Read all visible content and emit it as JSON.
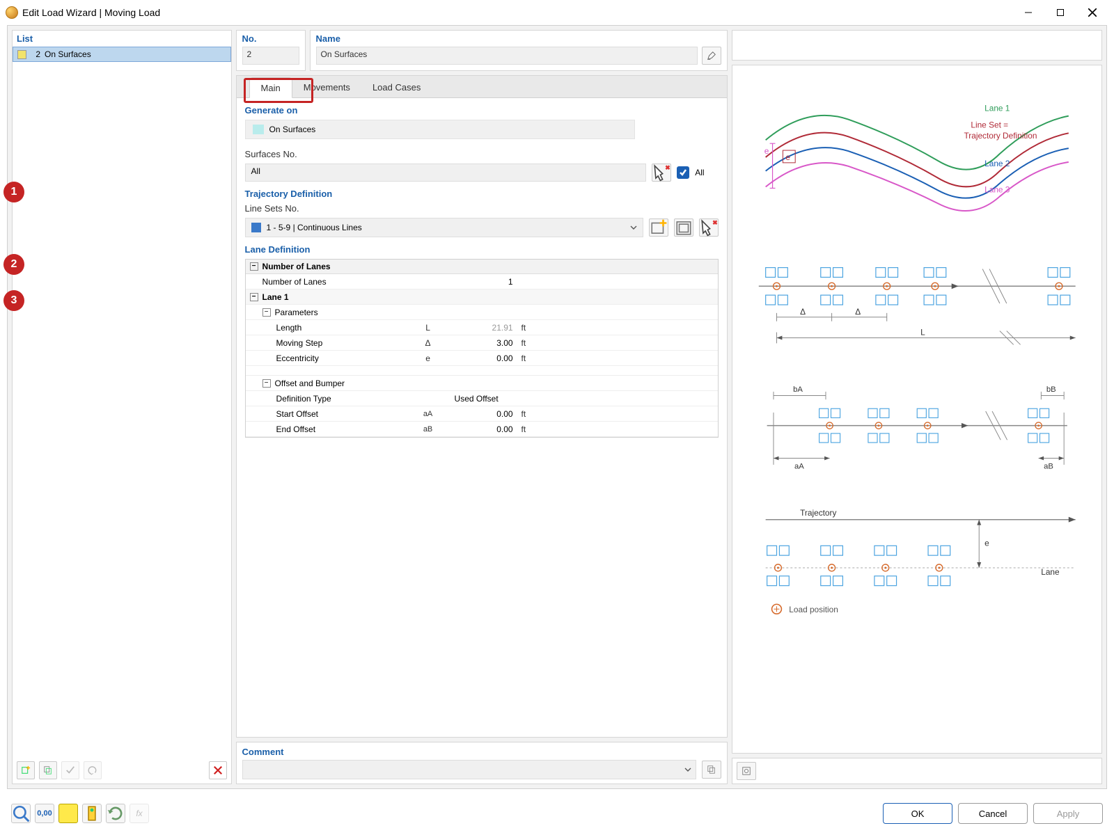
{
  "window": {
    "title": "Edit Load Wizard | Moving Load"
  },
  "list": {
    "header": "List",
    "items": [
      {
        "num": "2",
        "label": "On Surfaces"
      }
    ]
  },
  "header": {
    "no_label": "No.",
    "no_value": "2",
    "name_label": "Name",
    "name_value": "On Surfaces"
  },
  "tabs": {
    "main": "Main",
    "movements": "Movements",
    "load_cases": "Load Cases"
  },
  "main_tab": {
    "generate_on_title": "Generate on",
    "generate_on_value": "On Surfaces",
    "surfaces_no_label": "Surfaces No.",
    "surfaces_no_value": "All",
    "all_label": "All",
    "trajectory_title": "Trajectory Definition",
    "linesets_label": "Line Sets No.",
    "linesets_value": "1 - 5-9 | Continuous Lines",
    "lane_title": "Lane Definition",
    "lanes_hdr": "Number of Lanes",
    "lanes_label": "Number of Lanes",
    "lanes_value": "1",
    "lane1": "Lane 1",
    "params": "Parameters",
    "length_label": "Length",
    "length_sym": "L",
    "length_val": "21.91",
    "length_unit": "ft",
    "step_label": "Moving Step",
    "step_sym": "Δ",
    "step_val": "3.00",
    "step_unit": "ft",
    "ecc_label": "Eccentricity",
    "ecc_sym": "e",
    "ecc_val": "0.00",
    "ecc_unit": "ft",
    "offset_hdr": "Offset and Bumper",
    "def_type_label": "Definition Type",
    "def_type_val": "Used Offset",
    "start_off_label": "Start Offset",
    "start_off_sym": "aA",
    "start_off_val": "0.00",
    "start_off_unit": "ft",
    "end_off_label": "End Offset",
    "end_off_sym": "aB",
    "end_off_val": "0.00",
    "end_off_unit": "ft"
  },
  "preview": {
    "lane1": "Lane 1",
    "lineset": "Line Set =",
    "trajdef": "Trajectory Definition",
    "lane2": "Lane 2",
    "lane3": "Lane 3",
    "e": "e",
    "delta": "Δ",
    "L": "L",
    "bA": "bA",
    "bB": "bB",
    "aA": "aA",
    "aB": "aB",
    "trajectory": "Trajectory",
    "lane": "Lane",
    "load_pos": "Load position"
  },
  "comment": {
    "label": "Comment",
    "value": ""
  },
  "buttons": {
    "ok": "OK",
    "cancel": "Cancel",
    "apply": "Apply"
  },
  "annotations": [
    "1",
    "2",
    "3"
  ]
}
